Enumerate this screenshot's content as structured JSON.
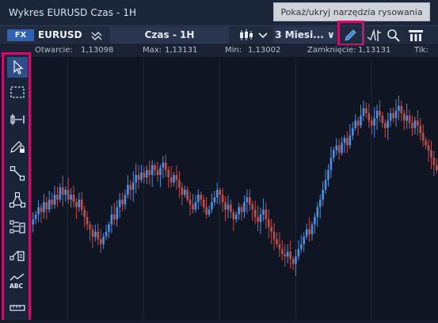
{
  "window": {
    "title": "Wykres EURUSD Czas - 1H"
  },
  "tooltip": {
    "text": "Pokaż/ukryj narzędzia rysowania"
  },
  "toolbar": {
    "badge": "FX",
    "symbol": "EURUSD",
    "interval_label": "Czas - 1H",
    "range_label": "3 Miesi... ∨",
    "icons": [
      "chart-type-icon",
      "candlestick-icon",
      "chevron-down-icon",
      "pencil-icon",
      "indicator-icon",
      "search-icon",
      "panel-settings-icon"
    ]
  },
  "infobar": {
    "open_label": "Otwarcie:",
    "open_value": "1,13098",
    "max_label": "Max:",
    "max_value": "1,13131",
    "min_label": "Min:",
    "min_value": "1,13002",
    "close_label": "Zamknięcie:",
    "close_value": "1,13131",
    "tick_label": "Tik:"
  },
  "sidebar": {
    "tools": [
      "cursor-arrow-icon",
      "selection-rectangle-icon",
      "measure-horizontal-icon",
      "pencil-lock-icon",
      "trendline-icon",
      "triangle-pattern-icon",
      "fibonacci-icon",
      "channel-icon",
      "text-abc-icon",
      "ruler-icon"
    ]
  },
  "colors": {
    "up": "#4f8fe0",
    "down": "#c0504d",
    "accent": "#c5126d",
    "background": "#0f1522"
  },
  "chart_data": {
    "type": "candlestick",
    "ohlc_price_path": [
      0.4,
      0.42,
      0.45,
      0.43,
      0.47,
      0.44,
      0.48,
      0.46,
      0.5,
      0.48,
      0.53,
      0.5,
      0.52,
      0.48,
      0.5,
      0.47,
      0.45,
      0.48,
      0.44,
      0.41,
      0.38,
      0.36,
      0.33,
      0.35,
      0.32,
      0.3,
      0.33,
      0.35,
      0.38,
      0.42,
      0.4,
      0.45,
      0.48,
      0.46,
      0.5,
      0.54,
      0.52,
      0.55,
      0.58,
      0.56,
      0.59,
      0.57,
      0.6,
      0.58,
      0.62,
      0.6,
      0.58,
      0.61,
      0.63,
      0.6,
      0.57,
      0.55,
      0.58,
      0.56,
      0.53,
      0.5,
      0.52,
      0.48,
      0.46,
      0.44,
      0.47,
      0.5,
      0.48,
      0.45,
      0.42,
      0.44,
      0.47,
      0.49,
      0.52,
      0.5,
      0.47,
      0.44,
      0.46,
      0.43,
      0.4,
      0.42,
      0.45,
      0.43,
      0.47,
      0.49,
      0.46,
      0.44,
      0.41,
      0.39,
      0.42,
      0.44,
      0.4,
      0.37,
      0.35,
      0.32,
      0.3,
      0.28,
      0.26,
      0.25,
      0.27,
      0.24,
      0.22,
      0.25,
      0.28,
      0.3,
      0.33,
      0.36,
      0.34,
      0.38,
      0.41,
      0.45,
      0.48,
      0.52,
      0.56,
      0.6,
      0.65,
      0.68,
      0.7,
      0.67,
      0.71,
      0.73,
      0.7,
      0.74,
      0.77,
      0.8,
      0.78,
      0.82,
      0.85,
      0.83,
      0.8,
      0.78,
      0.81,
      0.84,
      0.82,
      0.79,
      0.77,
      0.8,
      0.83,
      0.81,
      0.84,
      0.86,
      0.83,
      0.8,
      0.82,
      0.79,
      0.77,
      0.8,
      0.78,
      0.75,
      0.72,
      0.7,
      0.68,
      0.65,
      0.62,
      0.6
    ]
  }
}
